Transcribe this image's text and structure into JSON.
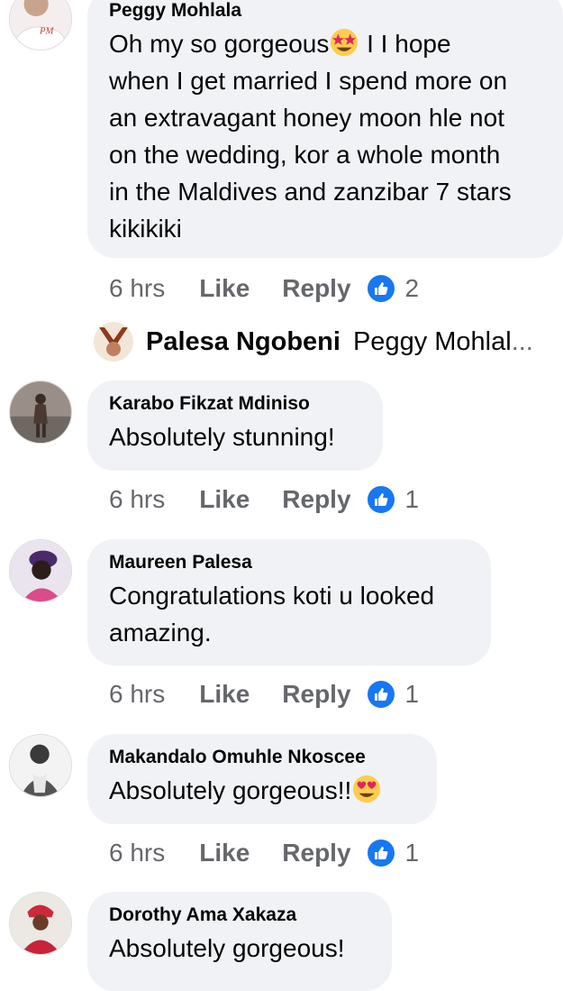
{
  "comments": [
    {
      "author": "Peggy Mohlala",
      "avatar_icon": "pm-avatar",
      "avatar_initials": "PM",
      "lines": [
        "Oh my so gorgeous",
        "when I get married I spend more on",
        "an extravagant honey moon hle not",
        "on the wedding, kor a whole month",
        "in the Maldives and zanzibar 7 stars",
        "kikikiki"
      ],
      "line1_after_emoji": " I I hope",
      "emoji": "star-struck-emoji",
      "time": "6 hrs",
      "like": "Like",
      "reply": "Reply",
      "reaction_icon": "like-reaction-icon",
      "reaction_count": "2"
    },
    {
      "author": "Karabo Fikzat Mdiniso",
      "avatar_icon": "photo-avatar",
      "lines": [
        "Absolutely stunning!"
      ],
      "time": "6 hrs",
      "like": "Like",
      "reply": "Reply",
      "reaction_icon": "like-reaction-icon",
      "reaction_count": "1"
    },
    {
      "author": "Maureen Palesa",
      "avatar_icon": "photo-avatar",
      "lines": [
        "Congratulations koti u looked",
        "amazing."
      ],
      "time": "6 hrs",
      "like": "Like",
      "reply": "Reply",
      "reaction_icon": "like-reaction-icon",
      "reaction_count": "1"
    },
    {
      "author": "Makandalo Omuhle Nkoscee",
      "avatar_icon": "photo-avatar",
      "lines": [
        "Absolutely gorgeous!!"
      ],
      "emoji": "heart-eyes-emoji",
      "time": "6 hrs",
      "like": "Like",
      "reply": "Reply",
      "reaction_icon": "like-reaction-icon",
      "reaction_count": "1"
    },
    {
      "author": "Dorothy Ama Xakaza",
      "avatar_icon": "photo-avatar",
      "lines": [
        "Absolutely gorgeous!"
      ]
    }
  ],
  "reply_preview": {
    "author": "Palesa Ngobeni",
    "text": "Peggy Mohlal",
    "ellipsis": "...",
    "avatar_icon": "photo-avatar"
  },
  "colors": {
    "bubble": "#f0f2f5",
    "meta_text": "#65676b",
    "like_blue": "#1877f2"
  }
}
